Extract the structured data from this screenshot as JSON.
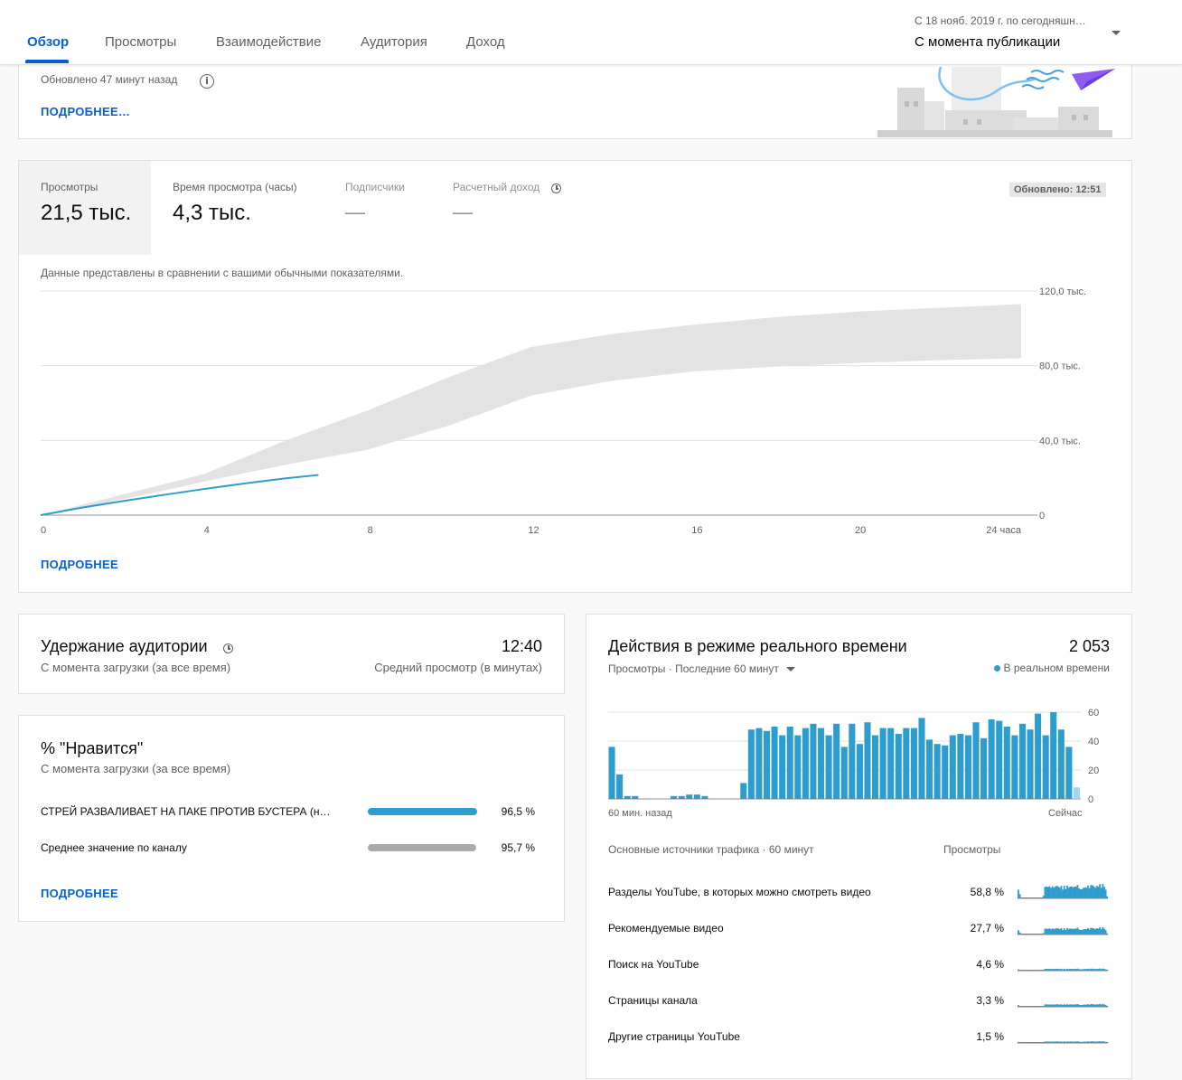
{
  "tabs": [
    {
      "label": "Обзор",
      "active": true
    },
    {
      "label": "Просмотры"
    },
    {
      "label": "Взаимодействие"
    },
    {
      "label": "Аудитория"
    },
    {
      "label": "Доход"
    }
  ],
  "period": {
    "range": "С 18 нояб. 2019 г. по сегодняшн…",
    "selected": "С момента публикации"
  },
  "top_card": {
    "updated": "Обновлено 47 минут назад",
    "more": "ПОДРОБНЕЕ…"
  },
  "metrics_card": {
    "metrics": [
      {
        "label": "Просмотры",
        "value": "21,5 тыс."
      },
      {
        "label": "Время просмотра (часы)",
        "value": "4,3 тыс."
      },
      {
        "label": "Подписчики",
        "value": "—"
      },
      {
        "label": "Расчетный доход",
        "value": "—"
      }
    ],
    "updated_badge": "Обновлено: 12:51",
    "comparison_note": "Данные представлены в сравнении с вашими обычными показателями.",
    "more": "ПОДРОБНЕЕ"
  },
  "chart_data": {
    "type": "line",
    "x_ticks": [
      "0",
      "4",
      "8",
      "12",
      "16",
      "20",
      "24 часа"
    ],
    "y_ticks": [
      "0",
      "40,0 тыс.",
      "80,0 тыс.",
      "120,0 тыс."
    ],
    "xlim": [
      0,
      24
    ],
    "ylim": [
      0,
      120000
    ],
    "grid": true,
    "band": {
      "x": [
        0,
        1,
        2,
        3,
        4,
        6,
        8,
        10,
        12,
        14,
        16,
        18,
        20,
        22,
        24
      ],
      "low": [
        0,
        4000,
        8500,
        13000,
        18000,
        27000,
        35000,
        48000,
        64000,
        72000,
        77000,
        79500,
        81500,
        83000,
        84000
      ],
      "high": [
        0,
        5500,
        11000,
        16500,
        22000,
        40000,
        56000,
        74000,
        90000,
        97000,
        102000,
        106000,
        109000,
        111000,
        113000
      ]
    },
    "series": [
      {
        "values_x": [
          0,
          1,
          2,
          3,
          4,
          5,
          6,
          6.8
        ],
        "values_y": [
          0,
          4000,
          7500,
          10800,
          14000,
          17000,
          19700,
          21500
        ],
        "color": "#2d9ccf"
      }
    ]
  },
  "retention": {
    "title": "Удержание аудитории",
    "subtitle": "С момента загрузки (за все время)",
    "value": "12:40",
    "value_label": "Средний просмотр (в минутах)"
  },
  "likes": {
    "title": "% \"Нравится\"",
    "subtitle": "С момента загрузки (за все время)",
    "rows": [
      {
        "label": "СТРЕЙ РАЗВАЛИВАЕТ НА ПАКЕ ПРОТИВ БУСТЕРА (н…",
        "value": "96,5 %",
        "fraction": 0.965,
        "color": "#2d9ccf"
      },
      {
        "label": "Среднее значение по каналу",
        "value": "95,7 %",
        "fraction": 0.957,
        "color": "#aaaaaa"
      }
    ],
    "more": "ПОДРОБНЕЕ"
  },
  "realtime": {
    "title": "Действия в режиме реального времени",
    "total": "2 053",
    "filter": "Просмотры · Последние 60 минут",
    "live": "В реальном времени",
    "y_ticks": [
      "0",
      "20",
      "40",
      "60"
    ],
    "x_start": "60 мин. назад",
    "x_end": "Сейчас",
    "bars": [
      36,
      17,
      2,
      2,
      0,
      0,
      0,
      0,
      2,
      2,
      3,
      3,
      2,
      0,
      0,
      0,
      0,
      11,
      48,
      49,
      47,
      50,
      44,
      50,
      44,
      49,
      52,
      49,
      44,
      52,
      36,
      52,
      38,
      53,
      44,
      49,
      49,
      45,
      49,
      49,
      56,
      41,
      38,
      37,
      44,
      45,
      44,
      53,
      42,
      55,
      54,
      50,
      44,
      52,
      48,
      59,
      44,
      60,
      48,
      36,
      8
    ],
    "sources_header": "Основные источники трафика · 60 минут",
    "sources_col": "Просмотры",
    "sources": [
      {
        "label": "Разделы YouTube, в которых можно смотреть видео",
        "value": "58,8 %",
        "scale": 1.0
      },
      {
        "label": "Рекомендуемые видео",
        "value": "27,7 %",
        "scale": 0.5
      },
      {
        "label": "Поиск на YouTube",
        "value": "4,6 %",
        "scale": 0.15
      },
      {
        "label": "Страницы канала",
        "value": "3,3 %",
        "scale": 0.2
      },
      {
        "label": "Другие страницы YouTube",
        "value": "1,5 %",
        "scale": 0.12
      }
    ]
  }
}
